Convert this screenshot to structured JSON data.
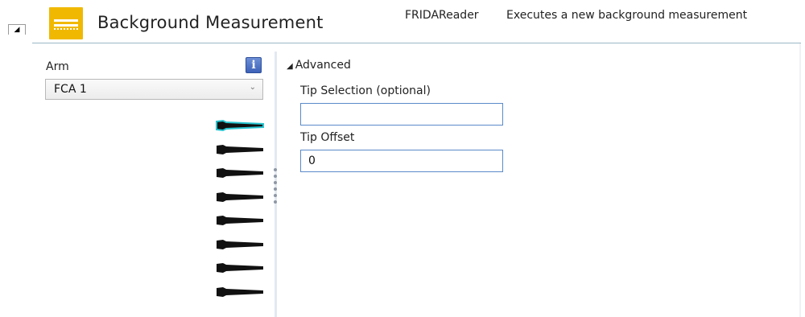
{
  "header": {
    "collapse_glyph": "◢",
    "title": "Background Measurement",
    "plugin_name": "FRIDAReader",
    "description": "Executes a new background measurement",
    "icon_color": "#f0b800"
  },
  "arm": {
    "label": "Arm",
    "info_glyph": "i",
    "selected": "FCA 1",
    "chevron": "⌄"
  },
  "tips": {
    "count": 8,
    "selected_index": 0,
    "highlight_color": "#27c4cf",
    "icon": "pipette-tip-icon"
  },
  "advanced": {
    "glyph": "◢",
    "label": "Advanced",
    "tip_selection": {
      "label": "Tip Selection (optional)",
      "value": ""
    },
    "tip_offset": {
      "label": "Tip Offset",
      "value": "0"
    }
  }
}
